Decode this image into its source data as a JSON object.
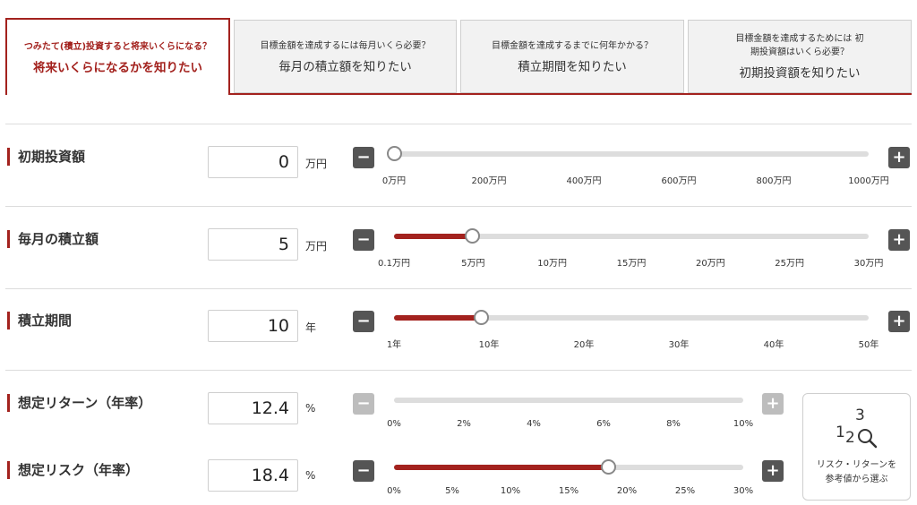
{
  "tabs": [
    {
      "sub": "つみたて(積立)投資すると将来いくらになる？",
      "main": "将来いくらになるかを知りたい",
      "active": true
    },
    {
      "sub": "目標金額を達成するには毎月いくら必要？",
      "main": "毎月の積立額を知りたい",
      "active": false
    },
    {
      "sub": "目標金額を達成するまでに何年かかる？",
      "main": "積立期間を知りたい",
      "active": false
    },
    {
      "sub": "目標金額を達成するためには 初期投資額はいくら必要？",
      "main": "初期投資額を知りたい",
      "active": false
    }
  ],
  "rows": [
    {
      "label": "初期投資額",
      "value": "0",
      "unit": "万円",
      "min": 0,
      "max": 1000,
      "current": 0,
      "minus_enabled": true,
      "plus_enabled": true,
      "ticks": [
        "0万円",
        "200万円",
        "400万円",
        "600万円",
        "800万円",
        "1000万円"
      ]
    },
    {
      "label": "毎月の積立額",
      "value": "5",
      "unit": "万円",
      "min": 0.1,
      "max": 30,
      "current": 5,
      "minus_enabled": true,
      "plus_enabled": true,
      "ticks": [
        "0.1万円",
        "5万円",
        "10万円",
        "15万円",
        "20万円",
        "25万円",
        "30万円"
      ]
    },
    {
      "label": "積立期間",
      "value": "10",
      "unit": "年",
      "min": 1,
      "max": 50,
      "current": 10,
      "minus_enabled": true,
      "plus_enabled": true,
      "ticks": [
        "1年",
        "10年",
        "20年",
        "30年",
        "40年",
        "50年"
      ]
    },
    {
      "label": "想定リターン（年率）",
      "value": "12.4",
      "unit": "%",
      "min": 0,
      "max": 10,
      "current": null,
      "minus_enabled": false,
      "plus_enabled": false,
      "ticks": [
        "0%",
        "2%",
        "4%",
        "6%",
        "8%",
        "10%"
      ]
    },
    {
      "label": "想定リスク（年率）",
      "value": "18.4",
      "unit": "%",
      "min": 0,
      "max": 30,
      "current": 18.4,
      "minus_enabled": true,
      "plus_enabled": true,
      "ticks": [
        "0%",
        "5%",
        "10%",
        "15%",
        "20%",
        "25%",
        "30%"
      ]
    }
  ],
  "buttons": {
    "minus": "−",
    "plus": "+"
  },
  "reference": {
    "icon": "magnifier-numbers-icon",
    "numerals": [
      "1",
      "2",
      "3"
    ],
    "line1": "リスク・リターンを",
    "line2": "参考値から選ぶ"
  },
  "colors": {
    "accent": "#a3221e",
    "button": "#555555",
    "button_disabled": "#bdbdbd",
    "track": "#dddddd"
  }
}
